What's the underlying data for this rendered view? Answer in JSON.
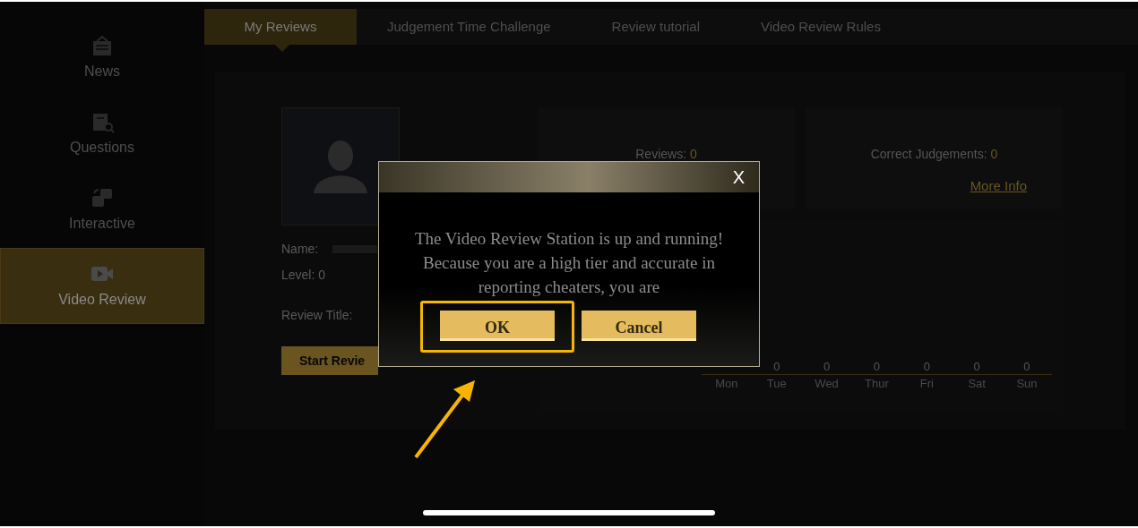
{
  "sidebar": {
    "items": [
      {
        "label": "News",
        "selected": false
      },
      {
        "label": "Questions",
        "selected": false
      },
      {
        "label": "Interactive",
        "selected": false
      },
      {
        "label": "Video Review",
        "selected": true
      }
    ]
  },
  "tabs": [
    {
      "label": "My Reviews",
      "selected": true
    },
    {
      "label": "Judgement Time Challenge",
      "selected": false
    },
    {
      "label": "Review tutorial",
      "selected": false
    },
    {
      "label": "Video Review Rules",
      "selected": false
    }
  ],
  "profile": {
    "name_label": "Name:",
    "level_label": "Level:",
    "level": "0",
    "review_title_label": "Review Title:",
    "start_button": "Start Revie"
  },
  "stats": [
    {
      "label": "Reviews:",
      "value": "0"
    },
    {
      "label": "Correct Judgements:",
      "value": "0",
      "link": "More Info"
    }
  ],
  "week": [
    {
      "day": "Mon"
    },
    {
      "day": "Tue",
      "value": "0"
    },
    {
      "day": "Wed",
      "value": "0"
    },
    {
      "day": "Thur",
      "value": "0"
    },
    {
      "day": "Fri",
      "value": "0"
    },
    {
      "day": "Sat",
      "value": "0"
    },
    {
      "day": "Sun",
      "value": "0"
    }
  ],
  "dialog": {
    "close": "X",
    "message": "The Video Review Station is up and running! Because you are a high tier and accurate in reporting cheaters, you are",
    "buttons": [
      {
        "label": "OK",
        "highlighted": true
      },
      {
        "label": "Cancel",
        "highlighted": false
      }
    ]
  }
}
